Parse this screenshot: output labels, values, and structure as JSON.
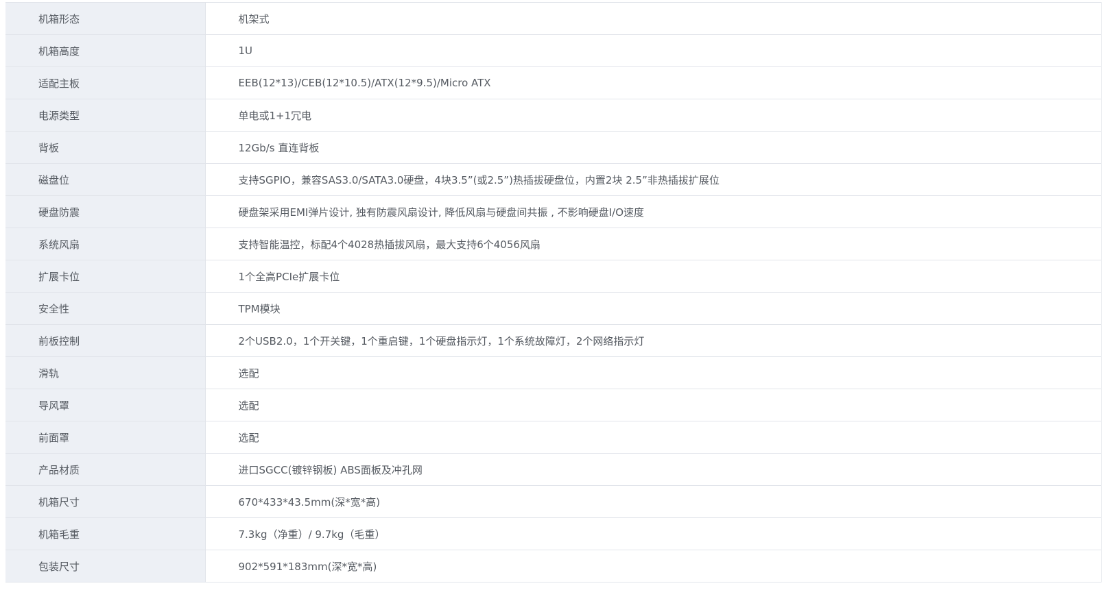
{
  "specs": [
    {
      "label": "机箱形态",
      "value": "机架式"
    },
    {
      "label": "机箱高度",
      "value": "1U"
    },
    {
      "label": "适配主板",
      "value": "EEB(12*13)/CEB(12*10.5)/ATX(12*9.5)/Micro ATX"
    },
    {
      "label": "电源类型",
      "value": "单电或1+1冗电"
    },
    {
      "label": "背板",
      "value": "12Gb/s 直连背板"
    },
    {
      "label": "磁盘位",
      "value": "支持SGPIO，兼容SAS3.0/SATA3.0硬盘，4块3.5”(或2.5”)热插拔硬盘位，内置2块 2.5”非热插拔扩展位"
    },
    {
      "label": "硬盘防震",
      "value": "硬盘架采用EMI弹片设计, 独有防震风扇设计, 降低风扇与硬盘间共振 , 不影响硬盘I/O速度"
    },
    {
      "label": "系统风扇",
      "value": "支持智能温控，标配4个4028热插拔风扇，最大支持6个4056风扇"
    },
    {
      "label": "扩展卡位",
      "value": "1个全高PCIe扩展卡位"
    },
    {
      "label": "安全性",
      "value": "TPM模块"
    },
    {
      "label": "前板控制",
      "value": "2个USB2.0，1个开关键，1个重启键，1个硬盘指示灯，1个系统故障灯，2个网络指示灯"
    },
    {
      "label": "滑轨",
      "value": "选配"
    },
    {
      "label": "导风罩",
      "value": "选配"
    },
    {
      "label": "前面罩",
      "value": "选配"
    },
    {
      "label": "产品材质",
      "value": "进口SGCC(镀锌钢板) ABS面板及冲孔网"
    },
    {
      "label": "机箱尺寸",
      "value": "670*433*43.5mm(深*宽*高)"
    },
    {
      "label": "机箱毛重",
      "value": "7.3kg（净重）/ 9.7kg（毛重）"
    },
    {
      "label": "包装尺寸",
      "value": "902*591*183mm(深*宽*高)"
    }
  ]
}
